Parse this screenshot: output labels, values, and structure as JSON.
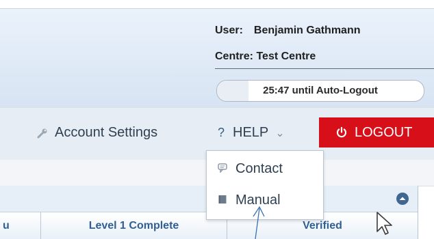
{
  "header": {
    "user_label": "User:",
    "user_name": "Benjamin Gathmann",
    "centre_label": "Centre:",
    "centre_name": "Test Centre",
    "auto_logout_text": "25:47 until Auto-Logout"
  },
  "nav": {
    "account_settings": "Account Settings",
    "help": "HELP",
    "logout": "LOGOUT"
  },
  "help_menu": {
    "items": [
      {
        "label": "Contact",
        "icon": "speech-bubble-icon"
      },
      {
        "label": "Manual",
        "icon": "book-icon"
      }
    ]
  },
  "table": {
    "columns": [
      "u",
      "Level 1 Complete",
      "Verified"
    ]
  },
  "colors": {
    "logout_bg": "#d70f18",
    "header_text": "#1f1f1f",
    "column_header_text": "#2f5f93"
  }
}
